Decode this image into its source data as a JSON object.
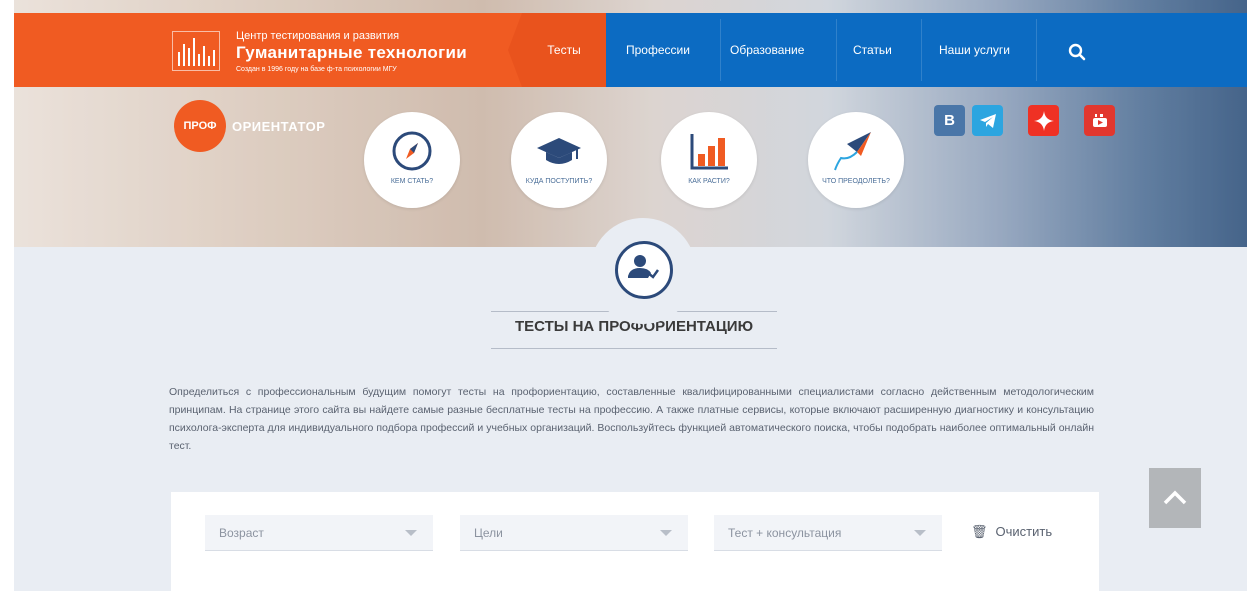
{
  "brand": {
    "line1": "Центр тестирования и развития",
    "line2": "Гуманитарные технологии",
    "line3": "Создан в 1996 году на базе ф-та психологии МГУ"
  },
  "nav": {
    "items": [
      "Тесты",
      "Профессии",
      "Образование",
      "Статьи",
      "Наши услуги"
    ]
  },
  "proforientator": {
    "badge": "ПРОФ",
    "name": "ОРИЕНТАТОР"
  },
  "circles": [
    {
      "label": "КЕМ СТАТЬ?",
      "icon": "compass-icon"
    },
    {
      "label": "КУДА ПОСТУПИТЬ?",
      "icon": "graduation-cap-icon"
    },
    {
      "label": "КАК РАСТИ?",
      "icon": "bar-chart-icon"
    },
    {
      "label": "ЧТО ПРЕОДОЛЕТЬ?",
      "icon": "kite-icon"
    }
  ],
  "social": [
    {
      "label": "В",
      "icon": "vk-icon",
      "color": "#4a76a8"
    },
    {
      "label": "",
      "icon": "telegram-icon",
      "color": "#2ca5e0"
    },
    {
      "label": "",
      "icon": "dzen-icon",
      "color": "#ef3124"
    },
    {
      "label": "",
      "icon": "youtube-icon",
      "color": "#e2372e"
    }
  ],
  "section": {
    "title": "ТЕСТЫ НА ПРОФОРИЕНТАЦИЮ",
    "intro": "Определиться с профессиональным будущим помогут тесты на профориентацию, составленные квалифицированными специалистами согласно действенным методологическим принципам. На странице этого сайта вы найдете самые разные бесплатные тесты на профессию. А также платные сервисы, которые включают расширенную диагностику и консультацию психолога-эксперта для индивидуального подбора профессий и учебных организаций. Воспользуйтесь функцией автоматического поиска, чтобы подобрать наиболее оптимальный онлайн тест."
  },
  "filters": {
    "age": "Возраст",
    "goals": "Цели",
    "type": "Тест + консультация",
    "clear": "Очистить"
  },
  "colors": {
    "brand_orange": "#f05b22",
    "nav_blue": "#0c6bc2",
    "dark_blue": "#2c4a7a"
  }
}
